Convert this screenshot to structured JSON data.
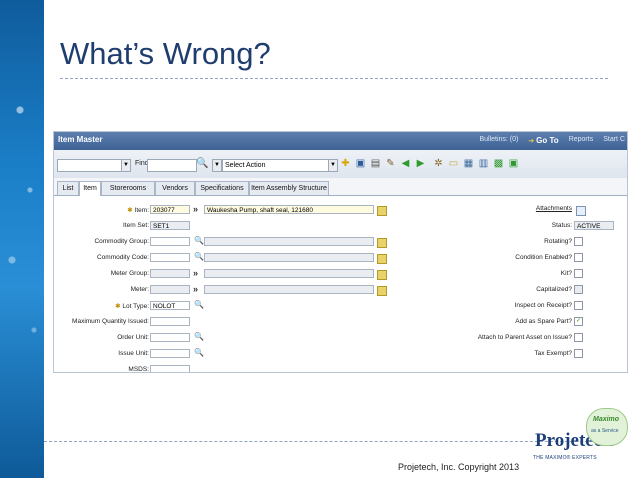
{
  "slide": {
    "title": "What’s Wrong?",
    "footer": "Projetech, Inc. Copyright 2013",
    "logo": {
      "name": "Projetech",
      "tagline": "THE MAXIMO® EXPERTS",
      "badge_top": "Maximo",
      "badge_bottom": "as a Service"
    }
  },
  "app": {
    "title": "Item Master",
    "header_links": {
      "bulletins": "Bulletins: (0)",
      "goto": "Go To",
      "reports": "Reports",
      "start": "Start C"
    },
    "toolbar": {
      "find_label": "Find:",
      "action_select": "Select Action"
    },
    "tabs": [
      "List",
      "Item",
      "Storerooms",
      "Vendors",
      "Specifications",
      "Item Assembly Structure"
    ],
    "active_tab": "Item",
    "fields": {
      "item": {
        "label": "Item:",
        "value": "203077",
        "description": "Waukesha Pump, shaft seal, 121680"
      },
      "item_set": {
        "label": "Item Set:",
        "value": "SET1"
      },
      "commodity_group": {
        "label": "Commodity Group:",
        "value": ""
      },
      "commodity_code": {
        "label": "Commodity Code:",
        "value": ""
      },
      "meter_group": {
        "label": "Meter Group:",
        "value": ""
      },
      "meter": {
        "label": "Meter:",
        "value": ""
      },
      "lot_type": {
        "label": "Lot Type:",
        "value": "NOLOT"
      },
      "max_qty_issued": {
        "label": "Maximum Quantity Issued:",
        "value": ""
      },
      "order_unit": {
        "label": "Order Unit:",
        "value": ""
      },
      "issue_unit": {
        "label": "Issue Unit:",
        "value": ""
      },
      "msds": {
        "label": "MSDS:",
        "value": ""
      }
    },
    "right": {
      "attachments": "Attachments",
      "status_label": "Status:",
      "status_value": "ACTIVE",
      "checks": [
        {
          "label": "Rotating?",
          "checked": false
        },
        {
          "label": "Condition Enabled?",
          "checked": false
        },
        {
          "label": "Kit?",
          "checked": false
        },
        {
          "label": "Capitalized?",
          "checked": false
        },
        {
          "label": "Inspect on Receipt?",
          "checked": false
        },
        {
          "label": "Add as Spare Part?",
          "checked": true
        },
        {
          "label": "Attach to Parent Asset on Issue?",
          "checked": false
        },
        {
          "label": "Tax Exempt?",
          "checked": false
        }
      ]
    }
  }
}
